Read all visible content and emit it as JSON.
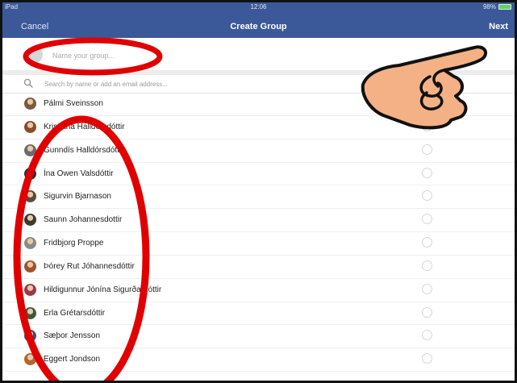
{
  "status_bar": {
    "carrier": "iPad",
    "time": "12:06",
    "battery": "98%"
  },
  "navbar": {
    "cancel_label": "Cancel",
    "title": "Create Group",
    "next_label": "Next"
  },
  "group_name": {
    "placeholder": "Name your group..."
  },
  "search": {
    "placeholder": "Search by name or add an email address..."
  },
  "contacts": [
    {
      "name": "Pálmi Sveinsson",
      "avatar_color": "#7a5a3a",
      "show_radio": false
    },
    {
      "name": "Kristjana Halldórsdóttir",
      "avatar_color": "#8a4b2b",
      "show_radio": true
    },
    {
      "name": "Gunndís Halldórsdóttir",
      "avatar_color": "#6b6b6b",
      "show_radio": true
    },
    {
      "name": "Ína Owen Valsdóttir",
      "avatar_color": "#2f2f3a",
      "show_radio": true
    },
    {
      "name": "Sigurvin Bjarnason",
      "avatar_color": "#5c4a3a",
      "show_radio": true
    },
    {
      "name": "Saunn Johannesdottir",
      "avatar_color": "#3a3a2f",
      "show_radio": true
    },
    {
      "name": "Fridbjorg Proppe",
      "avatar_color": "#8a8a8a",
      "show_radio": true
    },
    {
      "name": "Þórey Rut Jóhannesdóttir",
      "avatar_color": "#a0522d",
      "show_radio": true
    },
    {
      "name": "Hildigunnur Jónína Sigurðardóttir",
      "avatar_color": "#9a3b4b",
      "show_radio": true
    },
    {
      "name": "Erla Grétarsdóttir",
      "avatar_color": "#3a5a3a",
      "show_radio": true
    },
    {
      "name": "Sæþor Jensson",
      "avatar_color": "#4a4a6a",
      "show_radio": true
    },
    {
      "name": "Eggert Jondson",
      "avatar_color": "#b5652d",
      "show_radio": true
    }
  ],
  "annotations": {
    "highlight_color": "#e00000",
    "hand_icon": "pointing-hand-icon",
    "hand_fill": "#f4b185"
  },
  "colors": {
    "navbar_bg": "#3b5998",
    "navbar_text": "#ffffff"
  }
}
